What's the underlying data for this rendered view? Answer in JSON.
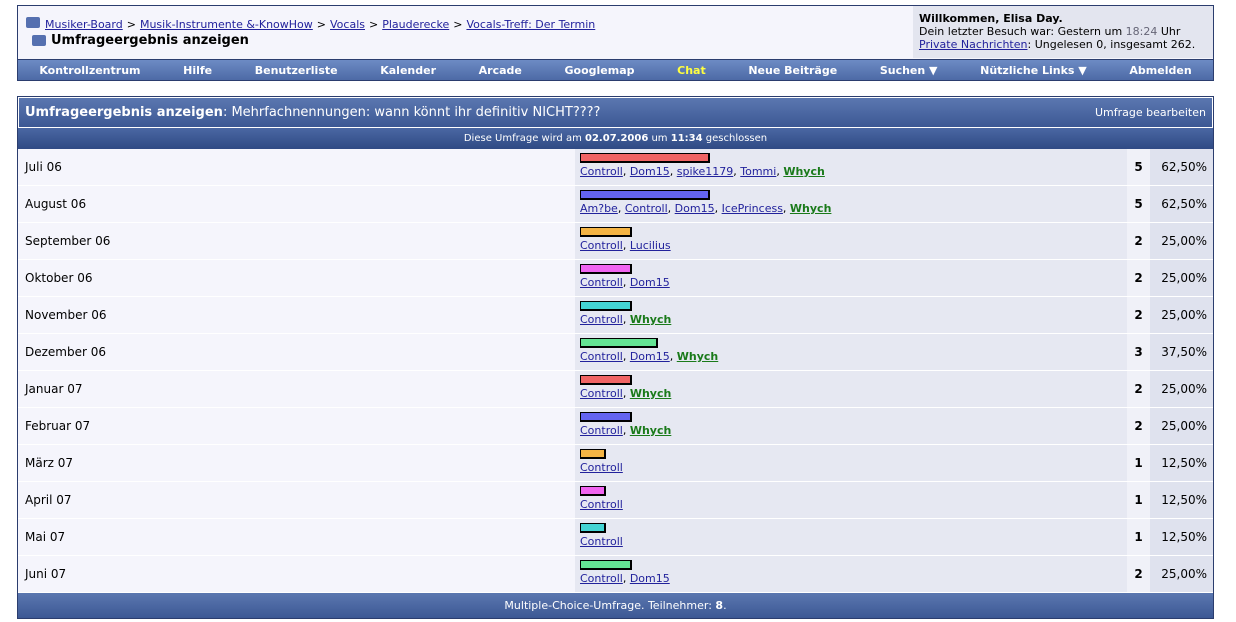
{
  "breadcrumb": [
    "Musiker-Board",
    "Musik-Instrumente &-KnowHow",
    "Vocals",
    "Plauderecke",
    "Vocals-Treff: Der Termin"
  ],
  "page_title": "Umfrageergebnis anzeigen",
  "welcome": {
    "greeting": "Willkommen, Elisa Day.",
    "last_visit_prefix": "Dein letzter Besuch war: Gestern um",
    "last_visit_time": "18:24",
    "last_visit_suffix": "Uhr",
    "pm_link": "Private Nachrichten",
    "pm_text": ": Ungelesen 0, insgesamt 262."
  },
  "nav": [
    "Kontrollzentrum",
    "Hilfe",
    "Benutzerliste",
    "Kalender",
    "Arcade",
    "Googlemap",
    "Chat",
    "Neue Beiträge",
    "Suchen ▼",
    "Nützliche Links ▼",
    "Abmelden"
  ],
  "poll": {
    "title_bold": "Umfrageergebnis anzeigen",
    "title_rest": ": Mehrfachnennungen: wann könnt ihr definitiv NICHT????",
    "edit": "Umfrage bearbeiten",
    "closed_prefix": "Diese Umfrage wird am",
    "closed_date": "02.07.2006",
    "closed_mid": "um",
    "closed_time": "11:34",
    "closed_suffix": "geschlossen",
    "footer_prefix": "Multiple-Choice-Umfrage. Teilnehmer:",
    "participants": "8",
    "options": [
      {
        "label": "Juli 06",
        "votes": 5,
        "percent": "62,50%",
        "color": "#f06464",
        "voters": [
          "Controll",
          "Dom15",
          "spike1179",
          "Tommi"
        ],
        "green": [
          "Whych"
        ]
      },
      {
        "label": "August 06",
        "votes": 5,
        "percent": "62,50%",
        "color": "#6464f0",
        "voters": [
          "Am?be",
          "Controll",
          "Dom15",
          "IcePrincess"
        ],
        "green": [
          "Whych"
        ]
      },
      {
        "label": "September 06",
        "votes": 2,
        "percent": "25,00%",
        "color": "#f4b444",
        "voters": [
          "Controll",
          "Lucilius"
        ],
        "green": []
      },
      {
        "label": "Oktober 06",
        "votes": 2,
        "percent": "25,00%",
        "color": "#f064f0",
        "voters": [
          "Controll",
          "Dom15"
        ],
        "green": []
      },
      {
        "label": "November 06",
        "votes": 2,
        "percent": "25,00%",
        "color": "#44d4d4",
        "voters": [
          "Controll"
        ],
        "green": [
          "Whych"
        ]
      },
      {
        "label": "Dezember 06",
        "votes": 3,
        "percent": "37,50%",
        "color": "#64e494",
        "voters": [
          "Controll",
          "Dom15"
        ],
        "green": [
          "Whych"
        ]
      },
      {
        "label": "Januar 07",
        "votes": 2,
        "percent": "25,00%",
        "color": "#f06464",
        "voters": [
          "Controll"
        ],
        "green": [
          "Whych"
        ]
      },
      {
        "label": "Februar 07",
        "votes": 2,
        "percent": "25,00%",
        "color": "#6464f0",
        "voters": [
          "Controll"
        ],
        "green": [
          "Whych"
        ]
      },
      {
        "label": "März 07",
        "votes": 1,
        "percent": "12,50%",
        "color": "#f4b444",
        "voters": [
          "Controll"
        ],
        "green": []
      },
      {
        "label": "April 07",
        "votes": 1,
        "percent": "12,50%",
        "color": "#f064f0",
        "voters": [
          "Controll"
        ],
        "green": []
      },
      {
        "label": "Mai 07",
        "votes": 1,
        "percent": "12,50%",
        "color": "#44d4d4",
        "voters": [
          "Controll"
        ],
        "green": []
      },
      {
        "label": "Juni 07",
        "votes": 2,
        "percent": "25,00%",
        "color": "#64e494",
        "voters": [
          "Controll",
          "Dom15"
        ],
        "green": []
      }
    ]
  }
}
